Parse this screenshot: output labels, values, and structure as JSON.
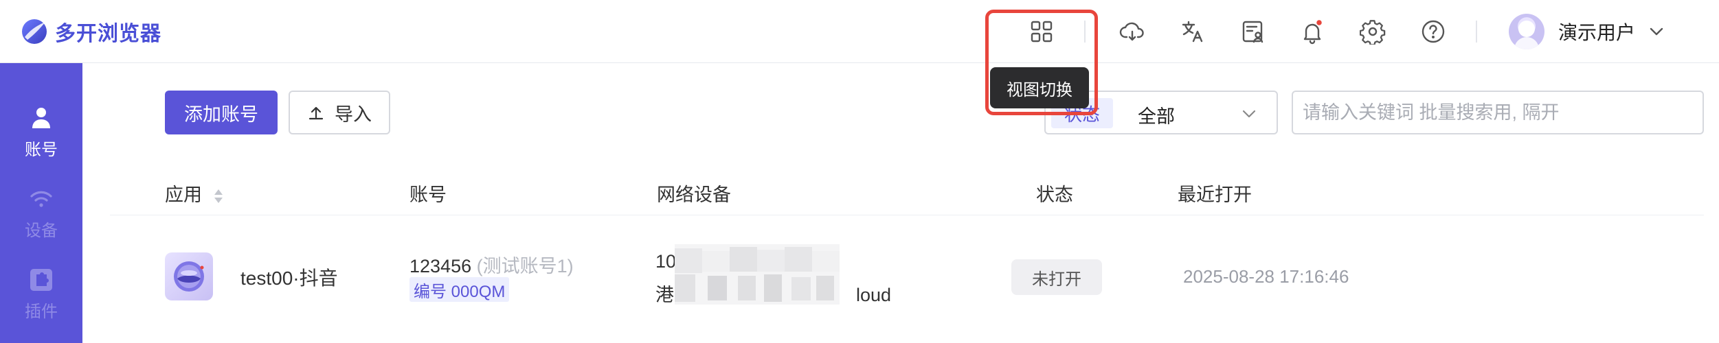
{
  "header": {
    "logo_text": "多开浏览器",
    "tooltip": "视图切换",
    "icons": [
      "view-grid-icon",
      "cloud-download-icon",
      "translate-icon",
      "user-card-icon",
      "bell-icon",
      "settings-gear-icon",
      "help-icon"
    ],
    "notification_dot": true,
    "user_name": "演示用户"
  },
  "sidebar": {
    "items": [
      {
        "label": "账号",
        "icon": "account-icon",
        "active": true
      },
      {
        "label": "设备",
        "icon": "wifi-icon",
        "active": false
      },
      {
        "label": "插件",
        "icon": "plugin-icon",
        "active": false
      }
    ]
  },
  "toolbar": {
    "add_label": "添加账号",
    "import_label": "导入",
    "status_tag": "状态",
    "status_value": "全部",
    "search_placeholder": "请输入关键词 批量搜索用, 隔开"
  },
  "table": {
    "columns": [
      "应用",
      "账号",
      "网络设备",
      "状态",
      "最近打开"
    ],
    "rows": [
      {
        "app": "test00·抖音",
        "account": "123456",
        "account_note": "(测试账号1)",
        "badge": "编号 000QM",
        "network_line1": "10",
        "network_line2_start": "港",
        "network_line2_end": "loud",
        "status": "未打开",
        "last_opened": "2025-08-28 17:16:46"
      }
    ]
  },
  "colors": {
    "primary": "#5a54d8",
    "highlight": "#e8453c",
    "logo": "#4a4fd6"
  }
}
